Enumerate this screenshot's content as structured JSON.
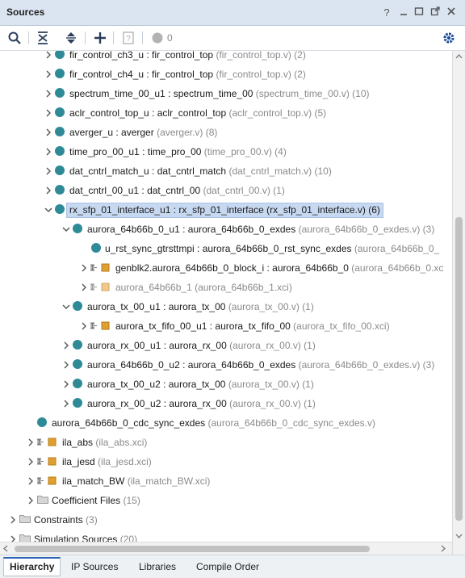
{
  "window": {
    "title": "Sources",
    "controls": [
      "help-icon",
      "minimize-icon",
      "restore-icon",
      "float-icon",
      "close-icon"
    ]
  },
  "toolbar": {
    "items": [
      "search-icon",
      "collapse-all-icon",
      "expand-all-icon",
      "add-sources-icon",
      "properties-icon",
      "status-dot-icon",
      "settings-icon"
    ],
    "status_count": "0"
  },
  "tree": {
    "rows": [
      {
        "name": "fir_control_ch3_u : fir_control_top",
        "file": "(fir_control_top.v) (2)"
      },
      {
        "name": "fir_control_ch4_u : fir_control_top",
        "file": "(fir_control_top.v) (2)"
      },
      {
        "name": "spectrum_time_00_u1 : spectrum_time_00",
        "file": "(spectrum_time_00.v) (10)"
      },
      {
        "name": "aclr_control_top_u : aclr_control_top",
        "file": "(aclr_control_top.v) (5)"
      },
      {
        "name": "averger_u : averger",
        "file": "(averger.v) (8)"
      },
      {
        "name": "time_pro_00_u1 : time_pro_00",
        "file": "(time_pro_00.v) (4)"
      },
      {
        "name": "dat_cntrl_match_u : dat_cntrl_match",
        "file": "(dat_cntrl_match.v) (10)"
      },
      {
        "name": "dat_cntrl_00_u1 : dat_cntrl_00",
        "file": "(dat_cntrl_00.v) (1)"
      },
      {
        "name": "rx_sfp_01_interface_u1 : rx_sfp_01_interface (rx_sfp_01_interface.v) (6)",
        "file": ""
      },
      {
        "name": "aurora_64b66b_0_u1 : aurora_64b66b_0_exdes",
        "file": "(aurora_64b66b_0_exdes.v) (3)"
      },
      {
        "name": "u_rst_sync_gtrsttmpi : aurora_64b66b_0_rst_sync_exdes",
        "file": "(aurora_64b66b_0_"
      },
      {
        "name": "genblk2.aurora_64b66b_0_block_i : aurora_64b66b_0",
        "file": "(aurora_64b66b_0.xc"
      },
      {
        "name": "",
        "file": "aurora_64b66b_1 (aurora_64b66b_1.xci)"
      },
      {
        "name": "aurora_tx_00_u1 : aurora_tx_00",
        "file": "(aurora_tx_00.v) (1)"
      },
      {
        "name": "aurora_tx_fifo_00_u1 : aurora_tx_fifo_00",
        "file": "(aurora_tx_fifo_00.xci)"
      },
      {
        "name": "aurora_rx_00_u1 : aurora_rx_00",
        "file": "(aurora_rx_00.v) (1)"
      },
      {
        "name": "aurora_64b66b_0_u2 : aurora_64b66b_0_exdes",
        "file": "(aurora_64b66b_0_exdes.v) (3)"
      },
      {
        "name": "aurora_tx_00_u2 : aurora_tx_00",
        "file": "(aurora_tx_00.v) (1)"
      },
      {
        "name": "aurora_rx_00_u2 : aurora_rx_00",
        "file": "(aurora_rx_00.v) (1)"
      },
      {
        "name": "aurora_64b66b_0_cdc_sync_exdes",
        "file": "(aurora_64b66b_0_cdc_sync_exdes.v)"
      },
      {
        "name": "ila_abs",
        "file": "(ila_abs.xci)"
      },
      {
        "name": "ila_jesd",
        "file": "(ila_jesd.xci)"
      },
      {
        "name": "ila_match_BW",
        "file": "(ila_match_BW.xci)"
      },
      {
        "name": "Coefficient Files",
        "file": "(15)"
      },
      {
        "name": "Constraints",
        "file": "(3)"
      },
      {
        "name": "Simulation Sources",
        "file": "(20)"
      }
    ]
  },
  "tabs": [
    "Hierarchy",
    "IP Sources",
    "Libraries",
    "Compile Order"
  ],
  "colors": {
    "accent": "#2e63b8",
    "module_dot": "#2f8a97",
    "ip_icon": "#e0a030",
    "selection": "#c7d9f1"
  }
}
